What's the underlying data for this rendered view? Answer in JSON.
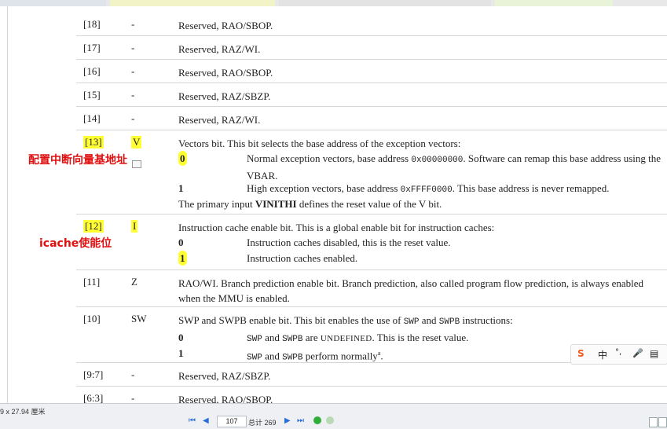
{
  "rows": [
    {
      "bits": "[18]",
      "name": "-",
      "desc": "Reserved, RAO/SBOP."
    },
    {
      "bits": "[17]",
      "name": "-",
      "desc": "Reserved, RAZ/WI."
    },
    {
      "bits": "[16]",
      "name": "-",
      "desc": "Reserved, RAO/SBOP."
    },
    {
      "bits": "[15]",
      "name": "-",
      "desc": "Reserved, RAZ/SBZP."
    },
    {
      "bits": "[14]",
      "name": "-",
      "desc": "Reserved, RAZ/WI."
    }
  ],
  "row13": {
    "bits": "[13]",
    "name": "V",
    "desc": "Vectors bit. This bit selects the base address of the exception vectors:",
    "v0_key": "0",
    "v0_pre": "Normal exception vectors, base address ",
    "v0_code": "0x00000000",
    "v0_post": ". Software can remap this base address using the VBAR.",
    "v1_key": "1",
    "v1_pre": "High exception vectors, base address ",
    "v1_code": "0xFFFF0000",
    "v1_post": ". This base address is never remapped.",
    "foot_pre": "The primary input ",
    "foot_bold": "VINITHI",
    "foot_post": " defines the reset value of the V bit."
  },
  "row12": {
    "bits": "[12]",
    "name": "I",
    "desc": "Instruction cache enable bit. This is a global enable bit for instruction caches:",
    "v0_key": "0",
    "v0": "Instruction caches disabled, this is the reset value.",
    "v1_key": "1",
    "v1": "Instruction caches enabled."
  },
  "row11": {
    "bits": "[11]",
    "name": "Z",
    "desc": "RAO/WI. Branch prediction enable bit. Branch prediction, also called program flow prediction, is always enabled when the MMU is enabled."
  },
  "row10": {
    "bits": "[10]",
    "name": "SW",
    "desc_pre": "SWP and SWPB enable bit. This bit enables the use of ",
    "swp": "SWP",
    "and": " and ",
    "swpb": "SWPB",
    "desc_post": " instructions:",
    "v0_key": "0",
    "v0_swp": "SWP",
    "v0_and": " and ",
    "v0_swpb": "SWPB",
    "v0_mid": " are ",
    "v0_undef": "UNDEFINED",
    "v0_post": ". This is the reset value.",
    "v1_key": "1",
    "v1_swp": "SWP",
    "v1_and": " and ",
    "v1_swpb": "SWPB",
    "v1_post": " perform normally",
    "v1_sup": "a",
    "v1_end": "."
  },
  "rows_end": [
    {
      "bits": "[9:7]",
      "name": "-",
      "desc": "Reserved, RAZ/SBZP."
    },
    {
      "bits": "[6:3]",
      "name": "-",
      "desc": "Reserved, RAO/SBOP."
    }
  ],
  "notes": {
    "vector": "配置中断向量基地址",
    "icache": "icache使能位"
  },
  "status": {
    "dims": "9 x 27.94 厘米",
    "page": "107",
    "total": "总计 269"
  },
  "ime": {
    "logo": "S",
    "lang": "中",
    "punct": "°,",
    "mic": "🎤",
    "kbd": "▤"
  },
  "colors": {
    "highlight": "#ffff33",
    "note": "#e01010",
    "nav": "#2a6fd8"
  }
}
